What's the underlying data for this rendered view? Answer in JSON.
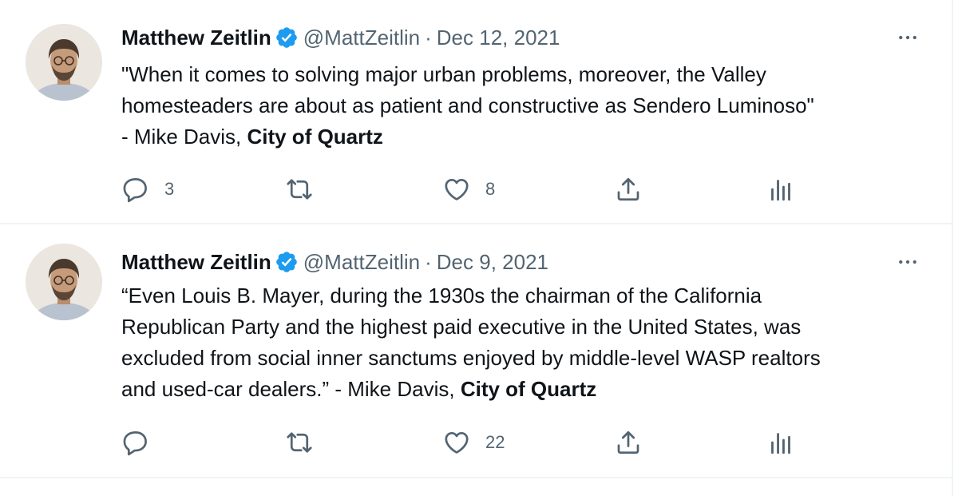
{
  "tweets": [
    {
      "author": {
        "name": "Matthew Zeitlin",
        "handle": "@MattZeitlin",
        "verified": true
      },
      "separator": "·",
      "date": "Dec 12, 2021",
      "text_parts": {
        "quote_line1": "\"When it comes to solving major urban problems, moreover, the Valley",
        "quote_line2": "homesteaders are about as patient and constructive as Sendero Luminoso\"",
        "attribution": "- Mike Davis, ",
        "book_title": "City of Quartz"
      },
      "stats": {
        "replies": "3",
        "retweets": "",
        "likes": "8"
      }
    },
    {
      "author": {
        "name": "Matthew Zeitlin",
        "handle": "@MattZeitlin",
        "verified": true
      },
      "separator": "·",
      "date": "Dec 9, 2021",
      "text_parts": {
        "quote_line1": "“Even Louis B. Mayer, during the 1930s the chairman of the California",
        "quote_line2": "Republican Party and the highest paid executive in the United States, was",
        "quote_line3": "excluded from social inner sanctums enjoyed by middle-level WASP realtors",
        "quote_line4": "and used-car dealers.” - Mike Davis, ",
        "book_title": "City of Quartz"
      },
      "stats": {
        "replies": "",
        "retweets": "",
        "likes": "22"
      }
    }
  ],
  "icons": {
    "verified": "verified-badge-icon",
    "more": "more-dots-icon",
    "reply": "reply-icon",
    "retweet": "retweet-icon",
    "like": "heart-icon",
    "share": "share-icon",
    "views": "analytics-icon"
  },
  "colors": {
    "verified_blue": "#1d9bf0",
    "icon_gray": "#536471",
    "text": "#0f1419",
    "divider": "#eff3f4"
  }
}
